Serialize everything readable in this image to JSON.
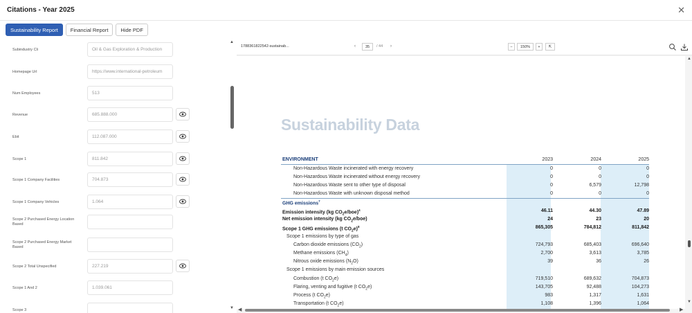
{
  "window": {
    "title": "Citations - Year 2025"
  },
  "tabs": [
    {
      "label": "Sustainability Report",
      "active": true
    },
    {
      "label": "Financial Report",
      "active": false
    },
    {
      "label": "Hide PDF",
      "active": false
    }
  ],
  "fields": [
    {
      "label": "Subindustry Cli",
      "value": "Oil & Gas Exploration & Production",
      "eye": false
    },
    {
      "label": "Homepage Url",
      "value": "https://www.international-petroleum",
      "eye": false
    },
    {
      "label": "Num Employees",
      "value": "513",
      "eye": false
    },
    {
      "label": "Revenue",
      "value": "685.888.000",
      "eye": true
    },
    {
      "label": "Ebit",
      "value": "112.087.000",
      "eye": true
    },
    {
      "label": "Scope 1",
      "value": "811.842",
      "eye": true
    },
    {
      "label": "Scope 1 Company Facilities",
      "value": "704.873",
      "eye": true
    },
    {
      "label": "Scope 1 Company Vehicles",
      "value": "1.064",
      "eye": true
    },
    {
      "label": "Scope 2 Purchased Energy Location Based",
      "value": "",
      "eye": false
    },
    {
      "label": "Scope 2 Purchased Energy Market Based",
      "value": "",
      "eye": false
    },
    {
      "label": "Scope 2 Total Unspecified",
      "value": "227.219",
      "eye": true
    },
    {
      "label": "Scope 1 And 2",
      "value": "1.039.061",
      "eye": false
    },
    {
      "label": "Scope 3",
      "value": "",
      "eye": false
    }
  ],
  "viewer": {
    "filename": "1788361822542-sustainab...",
    "page_current": "35",
    "page_total": "/ 44",
    "zoom_minus": "−",
    "zoom_level": "150%",
    "zoom_plus": "+",
    "fit": "⇱"
  },
  "pdf": {
    "heading": "Sustainability Data",
    "columns": [
      "2023",
      "2024",
      "2025"
    ],
    "section_environment": "ENVIRONMENT",
    "rows_waste": [
      {
        "label": "Non-Hazardous Waste incinerated with energy recovery",
        "values": [
          "0",
          "0",
          "0"
        ]
      },
      {
        "label": "Non-Hazardous Waste incinerated without energy recovery",
        "values": [
          "0",
          "0",
          "0"
        ]
      },
      {
        "label": "Non-Hazardous Waste sent to other type of disposal",
        "values": [
          "0",
          "6,579",
          "12,798"
        ]
      },
      {
        "label": "Non-Hazardous Waste with unknown disposal method",
        "values": [
          "0",
          "0",
          "0"
        ]
      }
    ],
    "section_ghg": "GHG emissions",
    "ghg_marker": "7",
    "rows_ghg": [
      {
        "pre": "Emission intensity (kg CO",
        "sub": "2",
        "post": "e/boe)",
        "sup": "4",
        "values": [
          "46.11",
          "44.30",
          "47.89"
        ],
        "bold": true,
        "indent": 0
      },
      {
        "pre": "Net emission intensity (kg CO",
        "sub": "2",
        "post": "e/boe)",
        "sup": "",
        "values": [
          "24",
          "23",
          "20"
        ],
        "bold": true,
        "indent": 0
      },
      {
        "pre": "Scope 1 GHG emissions (t CO",
        "sub": "2",
        "post": "e)",
        "sup": "8",
        "values": [
          "865,305",
          "784,812",
          "811,842"
        ],
        "bold": true,
        "indent": 0
      },
      {
        "pre": "Scope 1 emissions by type of gas",
        "sub": "",
        "post": "",
        "sup": "",
        "values": [
          "",
          "",
          ""
        ],
        "bold": false,
        "indent": 1
      },
      {
        "pre": "Carbon dioxide emissions (CO",
        "sub": "2",
        "post": ")",
        "sup": "",
        "values": [
          "724,793",
          "685,403",
          "696,640"
        ],
        "bold": false,
        "indent": 2
      },
      {
        "pre": "Methane emissions (CH",
        "sub": "4",
        "post": ")",
        "sup": "",
        "values": [
          "2,700",
          "3,613",
          "3,785"
        ],
        "bold": false,
        "indent": 2
      },
      {
        "pre": "Nitrous oxide emissions (N",
        "sub": "2",
        "post": "O)",
        "sup": "",
        "values": [
          "39",
          "36",
          "26"
        ],
        "bold": false,
        "indent": 2
      },
      {
        "pre": "Scope 1 emissions by main emission sources",
        "sub": "",
        "post": "",
        "sup": "",
        "values": [
          "",
          "",
          ""
        ],
        "bold": false,
        "indent": 1
      },
      {
        "pre": "Combustion (t CO",
        "sub": "2",
        "post": "e)",
        "sup": "",
        "values": [
          "719,510",
          "689,632",
          "704,873"
        ],
        "bold": false,
        "indent": 2
      },
      {
        "pre": "Flaring, venting and fugitive (t CO",
        "sub": "2",
        "post": "e)",
        "sup": "",
        "values": [
          "143,705",
          "92,488",
          "104,273"
        ],
        "bold": false,
        "indent": 2
      },
      {
        "pre": "Process (t CO",
        "sub": "2",
        "post": "e)",
        "sup": "",
        "values": [
          "983",
          "1,317",
          "1,631"
        ],
        "bold": false,
        "indent": 2
      },
      {
        "pre": "Transportation (t CO",
        "sub": "2",
        "post": "e)",
        "sup": "",
        "values": [
          "1,108",
          "1,396",
          "1,064"
        ],
        "bold": false,
        "indent": 2
      }
    ]
  },
  "colors": {
    "accent": "#2f5fb3",
    "table_band": "#ddeef8",
    "table_header": "#1b3f7a",
    "heading": "#c7d2de"
  }
}
